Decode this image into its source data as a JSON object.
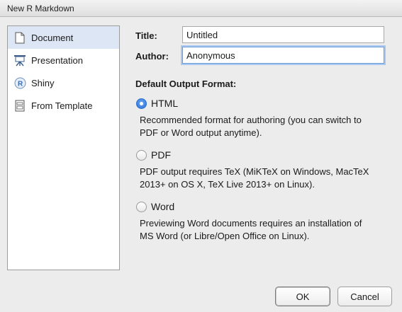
{
  "window": {
    "title": "New R Markdown"
  },
  "sidebar": {
    "items": [
      {
        "label": "Document",
        "icon": "document-icon",
        "selected": true
      },
      {
        "label": "Presentation",
        "icon": "presentation-icon",
        "selected": false
      },
      {
        "label": "Shiny",
        "icon": "shiny-icon",
        "selected": false
      },
      {
        "label": "From Template",
        "icon": "template-icon",
        "selected": false
      }
    ]
  },
  "form": {
    "title_label": "Title:",
    "title_value": "Untitled",
    "author_label": "Author:",
    "author_value": "Anonymous"
  },
  "output": {
    "section_title": "Default Output Format:",
    "options": [
      {
        "label": "HTML",
        "selected": true,
        "desc_line1": "Recommended format for authoring (you can switch to",
        "desc_line2": "PDF or Word output anytime)."
      },
      {
        "label": "PDF",
        "selected": false,
        "desc_line1": "PDF output requires TeX (MiKTeX on Windows, MacTeX",
        "desc_line2": "2013+ on OS X, TeX Live 2013+ on Linux)."
      },
      {
        "label": "Word",
        "selected": false,
        "desc_line1": "Previewing Word documents requires an installation of",
        "desc_line2": "MS Word (or Libre/Open Office on Linux)."
      }
    ]
  },
  "buttons": {
    "ok_label": "OK",
    "cancel_label": "Cancel"
  },
  "colors": {
    "accent": "#2c6fd3",
    "selection": "#dce6f4",
    "focus_ring": "#a9c8f0"
  }
}
